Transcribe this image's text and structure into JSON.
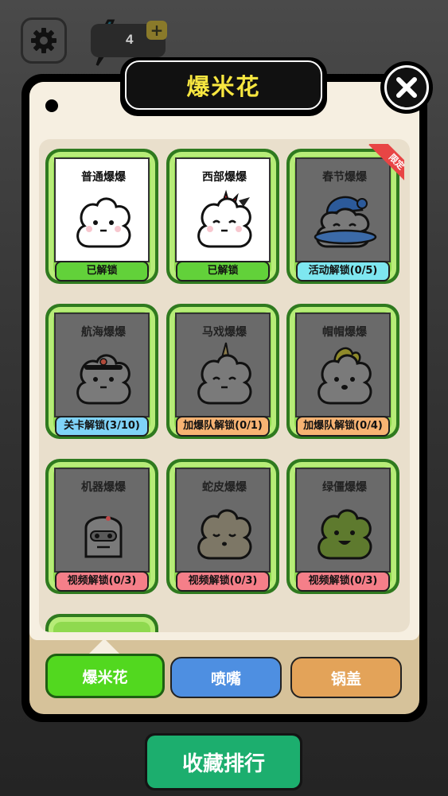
{
  "hud": {
    "energy_count": "4",
    "settings_icon": "gear-icon",
    "energy_icon": "lightning-icon",
    "add_icon": "plus-icon"
  },
  "modal": {
    "title": "爆米花",
    "close_icon": "close-icon",
    "limited_badge": "限定"
  },
  "cards": [
    {
      "name": "普通爆爆",
      "status": "已解锁",
      "unlocked": true,
      "tag_color": "#62d13a"
    },
    {
      "name": "西部爆爆",
      "status": "已解锁",
      "unlocked": true,
      "tag_color": "#62d13a"
    },
    {
      "name": "春节爆爆",
      "status": "活动解锁(0/5)",
      "unlocked": false,
      "tag_color": "#7ee7f0"
    },
    {
      "name": "航海爆爆",
      "status": "关卡解锁(3/10)",
      "unlocked": false,
      "tag_color": "#7fd3f7"
    },
    {
      "name": "马戏爆爆",
      "status": "加爆队解锁(0/1)",
      "unlocked": false,
      "tag_color": "#f7b373"
    },
    {
      "name": "帽帽爆爆",
      "status": "加爆队解锁(0/4)",
      "unlocked": false,
      "tag_color": "#f7b373"
    },
    {
      "name": "机器爆爆",
      "status": "视频解锁(0/3)",
      "unlocked": false,
      "tag_color": "#f57f89"
    },
    {
      "name": "蛇皮爆爆",
      "status": "视频解锁(0/3)",
      "unlocked": false,
      "tag_color": "#f57f89"
    },
    {
      "name": "绿僵爆爆",
      "status": "视频解锁(0/3)",
      "unlocked": false,
      "tag_color": "#f57f89"
    }
  ],
  "tabs": {
    "popcorn": "爆米花",
    "nozzle": "喷嘴",
    "lid": "锅盖"
  },
  "rank_button": "收藏排行"
}
